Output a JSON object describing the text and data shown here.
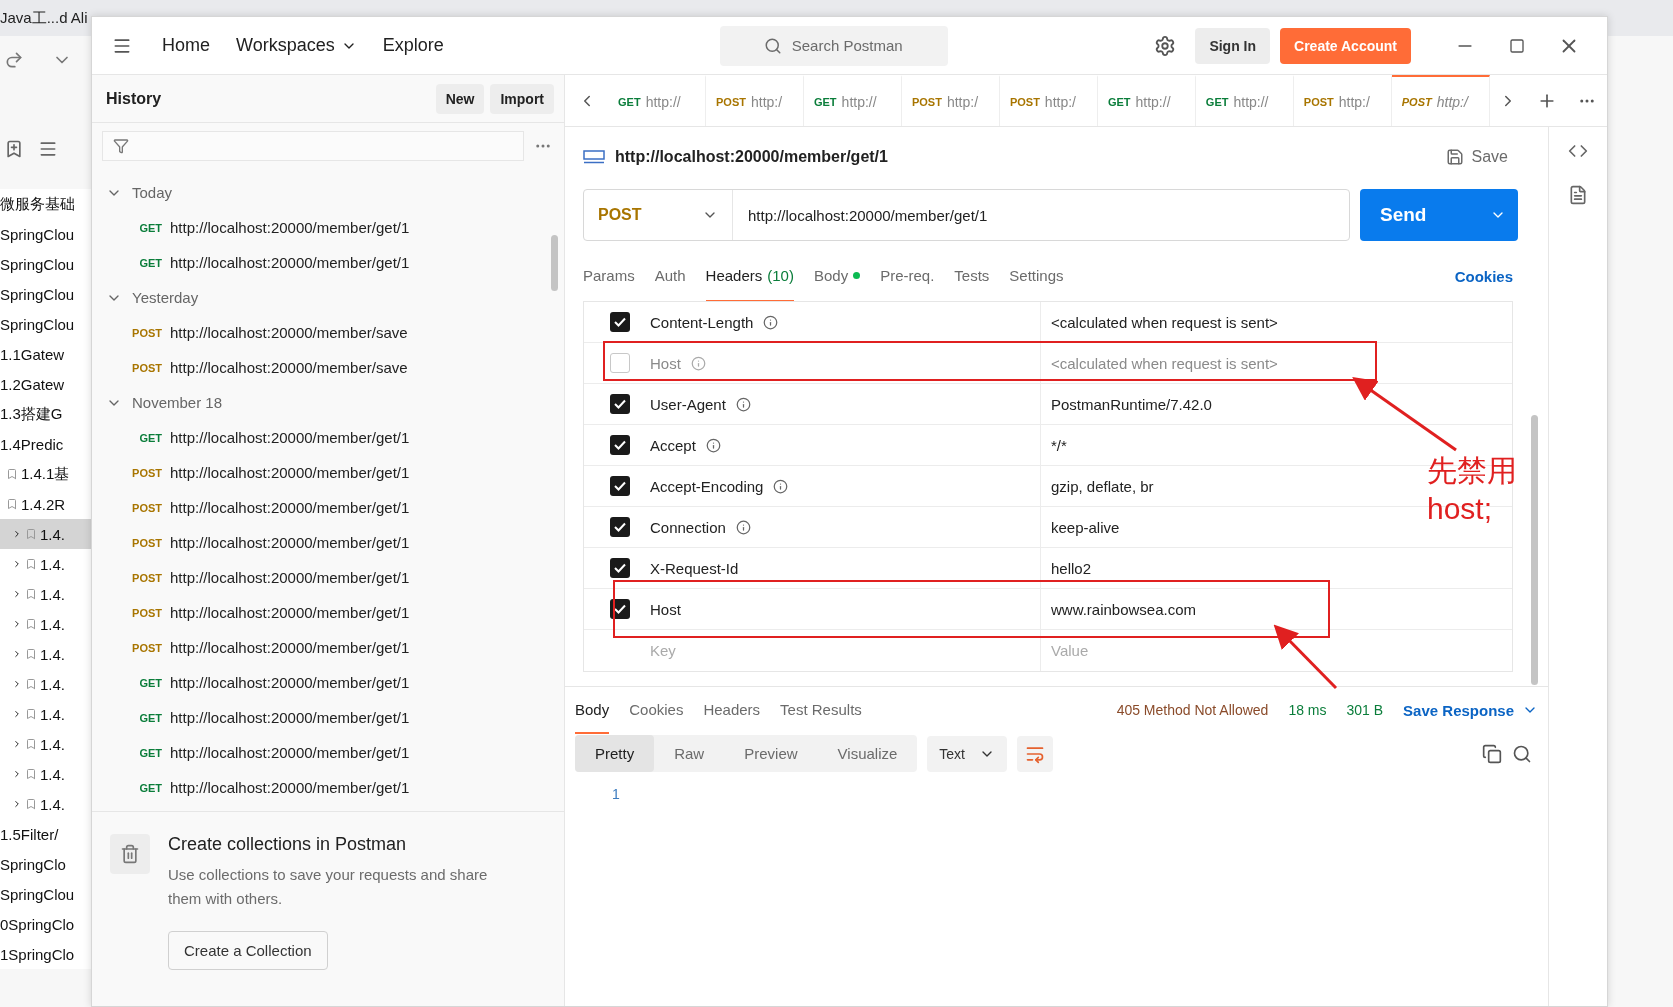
{
  "background_app": {
    "tab_title": "Java工...d Ali",
    "tree": [
      {
        "label": "微服务基础"
      },
      {
        "label": "SpringClou"
      },
      {
        "label": "SpringClou"
      },
      {
        "label": "SpringClou"
      },
      {
        "label": "SpringClou"
      },
      {
        "label": "1.1Gatew"
      },
      {
        "label": "1.2Gatew"
      },
      {
        "label": "1.3搭建G"
      },
      {
        "label": "1.4Predic",
        "children": [
          {
            "label": "1.4.1基"
          },
          {
            "label": "1.4.2R",
            "children": [
              {
                "label": "1.4.",
                "selected": true
              },
              {
                "label": "1.4.",
                "selected": false
              },
              {
                "label": "1.4.",
                "selected": false
              },
              {
                "label": "1.4.",
                "selected": false
              },
              {
                "label": "1.4.",
                "selected": false
              },
              {
                "label": "1.4.",
                "selected": false
              },
              {
                "label": "1.4.",
                "selected": false
              },
              {
                "label": "1.4.",
                "selected": false
              },
              {
                "label": "1.4.",
                "selected": false
              },
              {
                "label": "1.4.",
                "selected": false
              }
            ]
          }
        ]
      },
      {
        "label": "1.5Filter/"
      },
      {
        "label": "SpringClo"
      },
      {
        "label": "SpringClou"
      },
      {
        "label": "0SpringClo"
      },
      {
        "label": "1SpringClo"
      }
    ]
  },
  "nav": [
    {
      "label": "Home",
      "dropdown": false
    },
    {
      "label": "Workspaces",
      "dropdown": true
    },
    {
      "label": "Explore",
      "dropdown": false
    }
  ],
  "search": {
    "placeholder": "Search Postman"
  },
  "sign_in": "Sign In",
  "create_account": "Create Account",
  "sidebar": {
    "title": "History",
    "buttons": [
      "New",
      "Import"
    ],
    "groups": [
      {
        "label": "Today",
        "expanded": true,
        "items": [
          {
            "method": "GET",
            "url": "http://localhost:20000/member/get/1"
          },
          {
            "method": "GET",
            "url": "http://localhost:20000/member/get/1"
          }
        ]
      },
      {
        "label": "Yesterday",
        "expanded": true,
        "items": [
          {
            "method": "POST",
            "url": "http://localhost:20000/member/save"
          },
          {
            "method": "POST",
            "url": "http://localhost:20000/member/save"
          }
        ]
      },
      {
        "label": "November 18",
        "expanded": true,
        "items": [
          {
            "method": "GET",
            "url": "http://localhost:20000/member/get/1"
          },
          {
            "method": "POST",
            "url": "http://localhost:20000/member/get/1"
          },
          {
            "method": "POST",
            "url": "http://localhost:20000/member/get/1"
          },
          {
            "method": "POST",
            "url": "http://localhost:20000/member/get/1"
          },
          {
            "method": "POST",
            "url": "http://localhost:20000/member/get/1"
          },
          {
            "method": "POST",
            "url": "http://localhost:20000/member/get/1"
          },
          {
            "method": "POST",
            "url": "http://localhost:20000/member/get/1"
          },
          {
            "method": "GET",
            "url": "http://localhost:20000/member/get/1"
          },
          {
            "method": "GET",
            "url": "http://localhost:20000/member/get/1"
          },
          {
            "method": "GET",
            "url": "http://localhost:20000/member/get/1"
          },
          {
            "method": "GET",
            "url": "http://localhost:20000/member/get/1"
          }
        ]
      }
    ],
    "cta": {
      "title": "Create collections in Postman",
      "text": "Use collections to save your requests and share them with others.",
      "button": "Create a Collection"
    }
  },
  "tabs": [
    {
      "method": "GET",
      "label": "http://",
      "selected": false
    },
    {
      "method": "POST",
      "label": "http:/",
      "selected": false
    },
    {
      "method": "GET",
      "label": "http://",
      "selected": false
    },
    {
      "method": "POST",
      "label": "http:/",
      "selected": false
    },
    {
      "method": "POST",
      "label": "http:/",
      "selected": false
    },
    {
      "method": "GET",
      "label": "http://",
      "selected": false
    },
    {
      "method": "GET",
      "label": "http://",
      "selected": false
    },
    {
      "method": "POST",
      "label": "http:/",
      "selected": false
    },
    {
      "method": "POST",
      "label": "http:/",
      "selected": true
    }
  ],
  "request": {
    "title": "http://localhost:20000/member/get/1",
    "save": "Save",
    "method": "POST",
    "url": "http://localhost:20000/member/get/1",
    "send": "Send"
  },
  "request_tabs": [
    {
      "label": "Params",
      "selected": false
    },
    {
      "label": "Auth",
      "selected": false
    },
    {
      "label": "Headers",
      "count": "(10)",
      "selected": true
    },
    {
      "label": "Body",
      "dot": true,
      "selected": false
    },
    {
      "label": "Pre-req.",
      "selected": false
    },
    {
      "label": "Tests",
      "selected": false
    },
    {
      "label": "Settings",
      "selected": false
    }
  ],
  "cookies": "Cookies",
  "headers": [
    {
      "key": "Content-Length",
      "info": true,
      "value": "<calculated when request is sent>",
      "checked": true
    },
    {
      "key": "Host",
      "info": true,
      "value": "<calculated when request is sent>",
      "checked": false
    },
    {
      "key": "User-Agent",
      "info": true,
      "value": "PostmanRuntime/7.42.0",
      "checked": true
    },
    {
      "key": "Accept",
      "info": true,
      "value": "*/*",
      "checked": true
    },
    {
      "key": "Accept-Encoding",
      "info": true,
      "value": "gzip, deflate, br",
      "checked": true
    },
    {
      "key": "Connection",
      "info": true,
      "value": "keep-alive",
      "checked": true
    },
    {
      "key": "X-Request-Id",
      "info": false,
      "value": "hello2",
      "checked": true
    },
    {
      "key": "Host",
      "info": false,
      "value": "www.rainbowsea.com",
      "checked": true
    }
  ],
  "new_header": {
    "key_placeholder": "Key",
    "value_placeholder": "Value"
  },
  "response": {
    "tabs": [
      {
        "label": "Body",
        "selected": true
      },
      {
        "label": "Cookies",
        "selected": false
      },
      {
        "label": "Headers",
        "selected": false
      },
      {
        "label": "Test Results",
        "selected": false
      }
    ],
    "status": "405 Method Not Allowed",
    "time": "18 ms",
    "size": "301 B",
    "save": "Save Response",
    "views": [
      {
        "label": "Pretty",
        "selected": true
      },
      {
        "label": "Raw",
        "selected": false
      },
      {
        "label": "Preview",
        "selected": false
      },
      {
        "label": "Visualize",
        "selected": false
      }
    ],
    "format": "Text",
    "line_numbers": [
      "1"
    ]
  },
  "annotation": {
    "lines": [
      "先禁用",
      "host;"
    ]
  }
}
